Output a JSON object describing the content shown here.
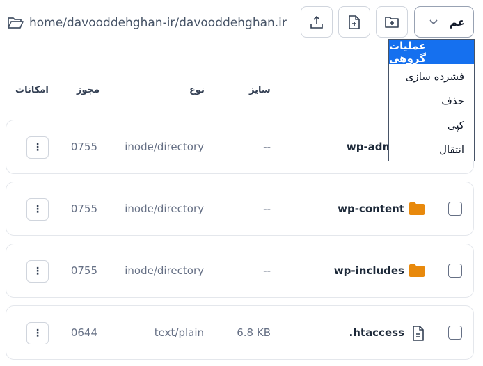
{
  "path": {
    "text": "home/davooddehghan-ir/davooddehghan.ir"
  },
  "toolbar": {
    "bulk_label": "عم",
    "upload_icon": "upload-icon",
    "new_file_icon": "new-file-icon",
    "new_folder_icon": "new-folder-icon"
  },
  "bulk_menu": {
    "options": [
      "عملیات گروهی",
      "فشرده سازی",
      "حذف",
      "کپی",
      "انتقال"
    ],
    "selected": "عملیات گروهی"
  },
  "table": {
    "headers": {
      "actions": "امکانات",
      "permission": "مجوز",
      "type": "نوع",
      "size": "سایز"
    },
    "rows": [
      {
        "name": "wp-admin",
        "icon": "folder-icon",
        "size": "--",
        "type": "inode/directory",
        "permission": "0755"
      },
      {
        "name": "wp-content",
        "icon": "folder-icon",
        "size": "--",
        "type": "inode/directory",
        "permission": "0755"
      },
      {
        "name": "wp-includes",
        "icon": "folder-icon",
        "size": "--",
        "type": "inode/directory",
        "permission": "0755"
      },
      {
        "name": ".htaccess",
        "icon": "file-icon",
        "size": "6.8 KB",
        "type": "text/plain",
        "permission": "0644"
      }
    ]
  },
  "colors": {
    "accent": "#1570ef",
    "folder": "#e8890c",
    "border": "#e4e7ec"
  }
}
